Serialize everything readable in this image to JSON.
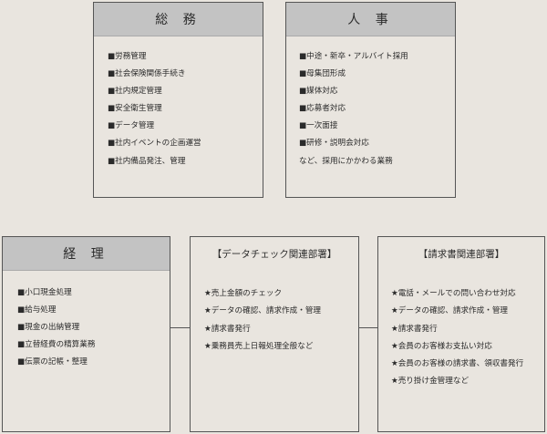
{
  "soumu": {
    "title": "総 務",
    "items": [
      "■労務管理",
      "■社会保険関係手続き",
      "■社内規定管理",
      "■安全衛生管理",
      "■データ管理",
      "■社内イベントの企画運営",
      "■社内備品発注、管理"
    ]
  },
  "jinji": {
    "title": "人 事",
    "items": [
      "■中途・新卒・アルバイト採用",
      "■母集団形成",
      "■媒体対応",
      "■応募者対応",
      "■一次面接",
      "■研修・説明会対応",
      "など、採用にかかわる業務"
    ]
  },
  "keiri": {
    "title": "経 理",
    "items": [
      "■小口現金処理",
      "■給与処理",
      "■現金の出納管理",
      "■立替経費の精算業務",
      "■伝票の記帳・整理"
    ]
  },
  "data_dept": {
    "title": "【データチェック関連部署】",
    "items": [
      "★売上金額のチェック",
      "★データの確認、請求作成・管理",
      "★請求書発行",
      "★乗務員売上日報処理全般など"
    ]
  },
  "seikyu_dept": {
    "title": "【請求書関連部署】",
    "items": [
      "★電話・メールでの問い合わせ対応",
      "★データの確認、請求作成・管理",
      "★請求書発行",
      "★会員のお客様お支払い対応",
      "★会員のお客様の請求書、領収書発行",
      "★売り掛け金管理など"
    ]
  }
}
